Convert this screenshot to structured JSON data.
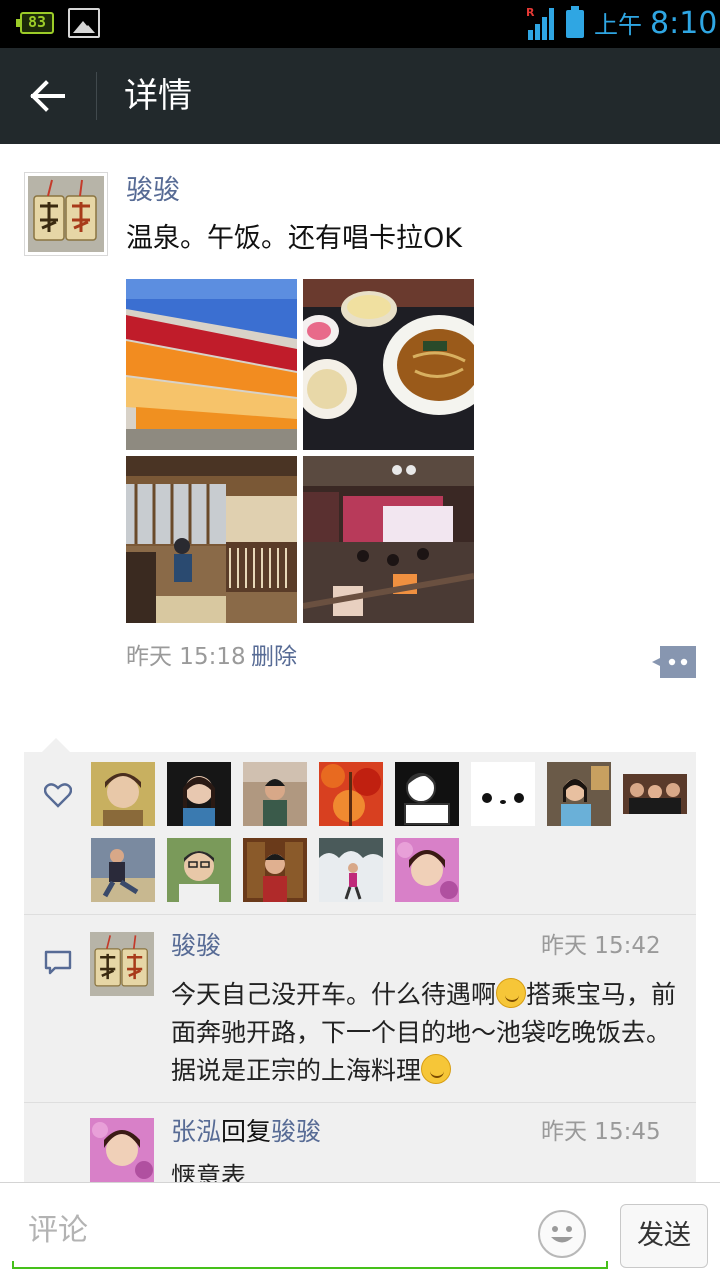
{
  "status_bar": {
    "battery_level": "83",
    "signal_label": "R",
    "ampm": "上午",
    "time": "8:10"
  },
  "header": {
    "title": "详情"
  },
  "post": {
    "author": "骏骏",
    "text": "温泉。午饭。还有唱卡拉OK",
    "photo_count": 4,
    "time": "昨天 15:18",
    "delete_label": "删除"
  },
  "likes": {
    "avatar_count": 13
  },
  "comments": [
    {
      "author": "骏骏",
      "time": "昨天 15:42",
      "text_a": "今天自己没开车。什么待遇啊",
      "text_b": "搭乘宝马，前面奔驰开路，下一个目的地～池袋吃晚饭去。据说是正宗的上海料理"
    },
    {
      "author": "张泓",
      "reply_word": "回复",
      "reply_to": "骏骏",
      "time": "昨天 15:45",
      "text": "惬意表"
    }
  ],
  "input": {
    "placeholder": "评论",
    "send_label": "发送"
  },
  "colors": {
    "titlebar": "#22292c",
    "link": "#576b95",
    "accent_green": "#45c01a",
    "panel": "#f0f0f0"
  }
}
